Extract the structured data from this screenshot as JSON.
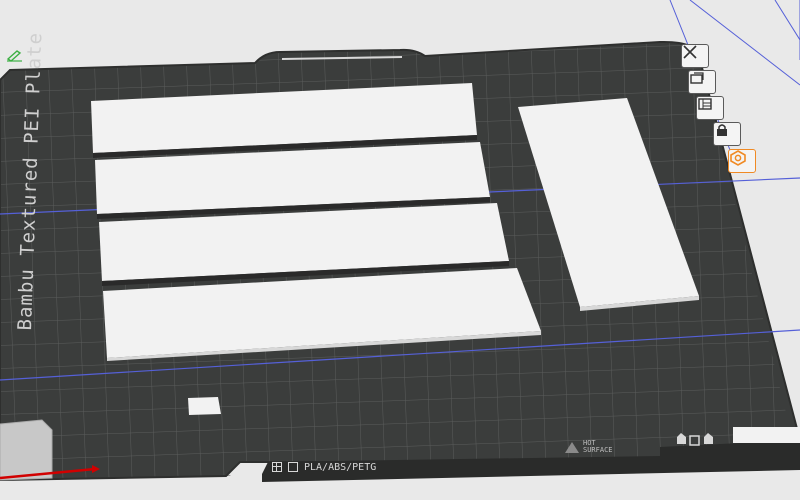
{
  "plate": {
    "name": "Bambu Textured PEI Plate",
    "materials": "PLA/ABS/PETG",
    "hot_surface_lines": [
      "HOT",
      "SURFACE"
    ]
  },
  "colors": {
    "plate": "#3b3d3c",
    "grid": "#5b5d5c",
    "part": "#f2f2f2",
    "part_side": "#2a2a2a",
    "accent_orange": "#f08a24",
    "axis_x": "#d10000",
    "axis_line": "#5560d8",
    "edit_green": "#3cb043"
  },
  "toolbar": {
    "buttons": [
      {
        "name": "close-plate-icon"
      },
      {
        "name": "orient-icon"
      },
      {
        "name": "arrange-icon"
      },
      {
        "name": "lock-icon"
      },
      {
        "name": "plate-settings-icon",
        "active": true
      }
    ]
  },
  "objects": [
    {
      "name": "part-1"
    },
    {
      "name": "part-2"
    },
    {
      "name": "part-3"
    },
    {
      "name": "part-4"
    },
    {
      "name": "part-5"
    },
    {
      "name": "part-6"
    }
  ]
}
